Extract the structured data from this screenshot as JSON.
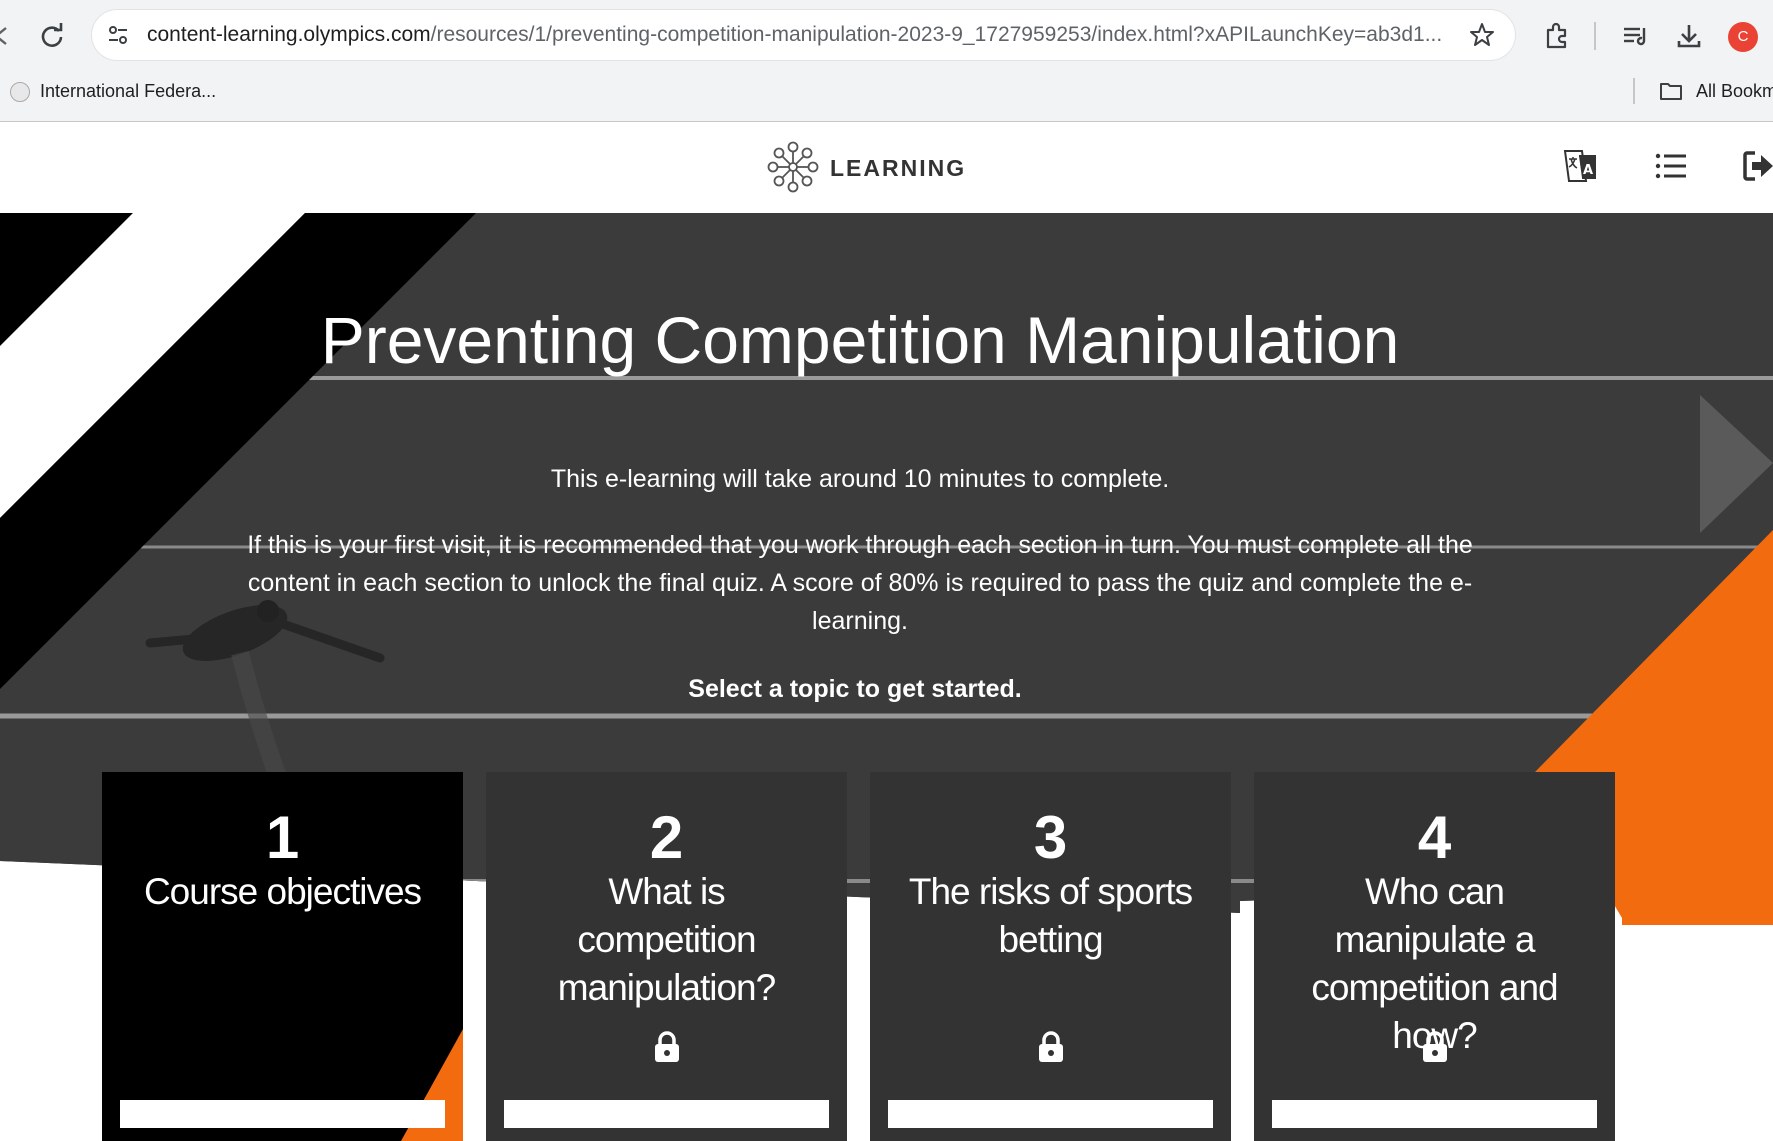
{
  "browser": {
    "url_host": "content-learning.olympics.com",
    "url_path": "/resources/1/preventing-competition-manipulation-2023-9_1727959253/index.html?xAPILaunchKey=ab3d1...",
    "profile_initial": "C",
    "bookmark_label": "International Federa...",
    "all_bookmarks_label": "All Bookm",
    "icons": [
      "reload-icon",
      "site-info-icon",
      "star-icon",
      "extensions-icon",
      "media-controls-icon",
      "download-icon",
      "folder-icon"
    ]
  },
  "header": {
    "logo_text": "LEARNING",
    "buttons": [
      "translate-icon",
      "menu-list-icon",
      "exit-icon"
    ]
  },
  "hero": {
    "title": "Preventing Competition Manipulation",
    "duration_text": "This e-learning will take around 10 minutes to complete.",
    "instructions_text": "If this is your first visit, it is recommended that you work through each section in turn. You must complete all the content in each section to unlock the final quiz. A score of 80% is required to pass the quiz and complete the e-learning.",
    "cta_text": "Select a topic to get started."
  },
  "topics": [
    {
      "number": "1",
      "title": "Course objectives",
      "locked": false,
      "active": true
    },
    {
      "number": "2",
      "title": "What is competition manipulation?",
      "locked": true,
      "active": false
    },
    {
      "number": "3",
      "title": "The risks of sports betting",
      "locked": true,
      "active": false
    },
    {
      "number": "4",
      "title": "Who can manipulate a competition and how?",
      "locked": true,
      "active": false
    }
  ],
  "colors": {
    "accent_orange": "#f26b0f",
    "hero_dark": "#3a3a3a",
    "card_dark": "#333333",
    "card_active": "#000000"
  }
}
